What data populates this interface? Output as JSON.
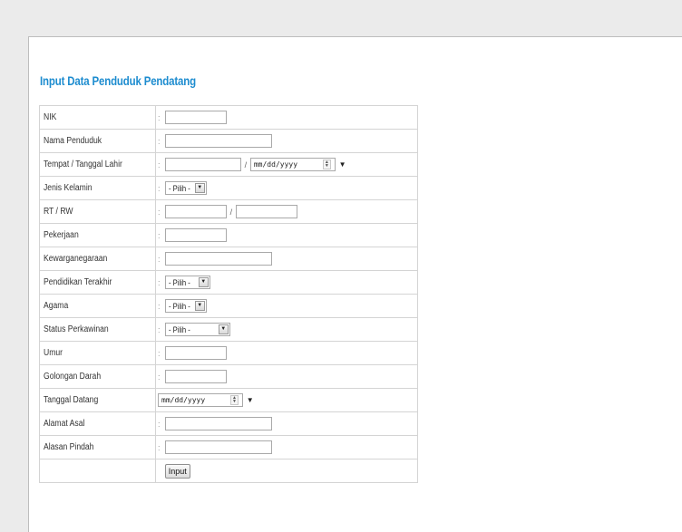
{
  "page": {
    "title": "Input Data Penduduk Pendatang"
  },
  "form": {
    "separator": ":",
    "rows": {
      "nik": {
        "label": "NIK",
        "value": ""
      },
      "nama": {
        "label": "Nama Penduduk",
        "value": ""
      },
      "ttl": {
        "label": "Tempat / Tanggal Lahir",
        "place_value": "",
        "slash": "/",
        "date_placeholder": "mm/dd/yyyy"
      },
      "jk": {
        "label": "Jenis Kelamin",
        "selected": "- Pilih -"
      },
      "rtrw": {
        "label": "RT / RW",
        "rt_value": "",
        "slash": "/",
        "rw_value": ""
      },
      "pekerjaan": {
        "label": "Pekerjaan",
        "value": ""
      },
      "kewarganegaraan": {
        "label": "Kewarganegaraan",
        "value": ""
      },
      "pendidikan": {
        "label": "Pendidikan Terakhir",
        "selected": "- Pilih -"
      },
      "agama": {
        "label": "Agama",
        "selected": "- Pilih -"
      },
      "status": {
        "label": "Status Perkawinan",
        "selected": "- Pilih -"
      },
      "umur": {
        "label": "Umur",
        "value": ""
      },
      "goldar": {
        "label": "Golongan Darah",
        "value": ""
      },
      "tgldatang": {
        "label": "Tanggal Datang",
        "date_placeholder": "mm/dd/yyyy"
      },
      "alamat": {
        "label": "Alamat Asal",
        "value": ""
      },
      "alasan": {
        "label": "Alasan Pindah",
        "value": ""
      }
    },
    "submit_label": "Input"
  },
  "icons": {
    "spinner": "spinner-icon",
    "dropdown_arrow": "dropdown-arrow-icon",
    "select_arrow": "select-arrow-icon"
  }
}
